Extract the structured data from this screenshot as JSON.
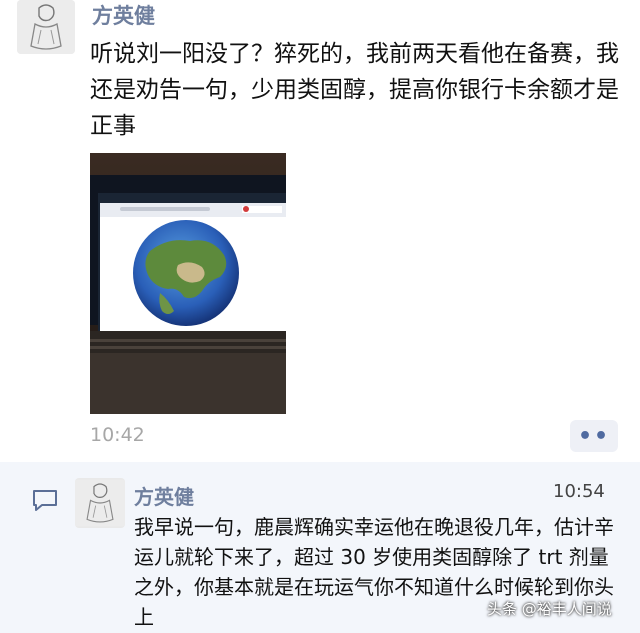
{
  "post": {
    "author": "方英健",
    "text": "听说刘一阳没了？猝死的，我前两天看他在备赛，我还是劝告一句，少用类固醇，提高你银行卡余额才是正事",
    "time": "10:42",
    "more_label": "••"
  },
  "comment": {
    "author": "方英健",
    "time": "10:54",
    "text": "我早说一句，鹿晨辉确实幸运他在晚退役几年，估计辛运儿就轮下来了，超过 30 岁使用类固醇除了 trt 剂量之外，你基本就是在玩运气你不知道什么时候轮到你头上"
  },
  "watermark": "头条 @裕丰人间说",
  "icons": {
    "avatar": "avatar-sketch",
    "comment": "comment-icon",
    "more": "more-dots-icon"
  },
  "colors": {
    "name": "#6f7f9e",
    "comment_bg": "#f3f6fb",
    "more_dots": "#4f6aa0"
  }
}
